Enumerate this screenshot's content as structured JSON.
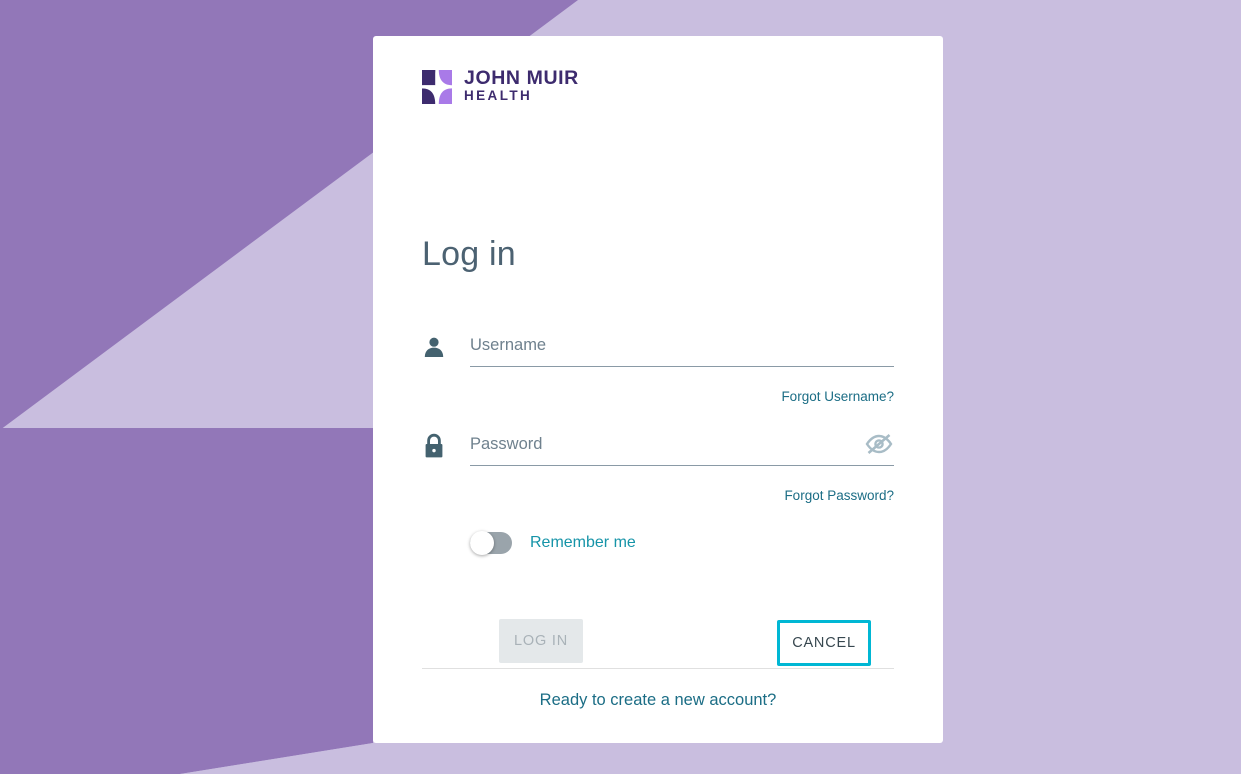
{
  "brand": {
    "logo_icon": "john-muir-butterfly-mark",
    "name_line1": "JOHN MUIR",
    "name_line2": "HEALTH",
    "logo_dark_purple": "#3d2b6e",
    "logo_light_purple": "#a97ae8"
  },
  "page": {
    "title": "Log in",
    "title_color": "#4c6272"
  },
  "background": {
    "base_purple": "#9277b8",
    "light_purple": "#c9bedf"
  },
  "form": {
    "username": {
      "icon": "person-icon",
      "placeholder": "Username",
      "value": "",
      "forgot_label": "Forgot Username?"
    },
    "password": {
      "icon": "lock-icon",
      "placeholder": "Password",
      "value": "",
      "visibility_icon": "eye-slash-icon",
      "forgot_label": "Forgot Password?"
    },
    "remember_me": {
      "label": "Remember me",
      "checked": false,
      "label_color": "#1694a8"
    }
  },
  "actions": {
    "login_label": "LOG IN",
    "login_enabled": false,
    "cancel_label": "CANCEL",
    "cancel_border_color": "#00b7d4"
  },
  "footer": {
    "create_account_label": "Ready to create a new account?",
    "link_color": "#1b6d85"
  }
}
